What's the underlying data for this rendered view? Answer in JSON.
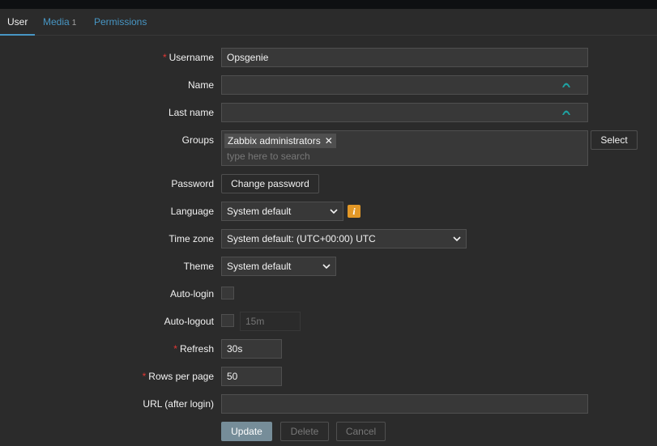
{
  "tabs": [
    {
      "label": "User",
      "count": ""
    },
    {
      "label": "Media",
      "count": "1"
    },
    {
      "label": "Permissions",
      "count": ""
    }
  ],
  "form": {
    "username": {
      "label": "Username",
      "value": "Opsgenie"
    },
    "name": {
      "label": "Name",
      "value": ""
    },
    "lastname": {
      "label": "Last name",
      "value": ""
    },
    "groups": {
      "label": "Groups",
      "chip": "Zabbix administrators",
      "placeholder": "type here to search",
      "select_label": "Select"
    },
    "password": {
      "label": "Password",
      "button": "Change password"
    },
    "language": {
      "label": "Language",
      "value": "System default"
    },
    "timezone": {
      "label": "Time zone",
      "value": "System default: (UTC+00:00) UTC"
    },
    "theme": {
      "label": "Theme",
      "value": "System default"
    },
    "autologin": {
      "label": "Auto-login",
      "checked": false
    },
    "autologout": {
      "label": "Auto-logout",
      "checked": false,
      "placeholder": "15m"
    },
    "refresh": {
      "label": "Refresh",
      "value": "30s"
    },
    "rows": {
      "label": "Rows per page",
      "value": "50"
    },
    "url": {
      "label": "URL (after login)",
      "value": ""
    }
  },
  "actions": {
    "update": "Update",
    "delete": "Delete",
    "cancel": "Cancel"
  },
  "icons": {
    "info": "info-icon",
    "eye": "password-manager-icon",
    "chevron": "chevron-down-icon",
    "remove": "close-icon"
  },
  "colors": {
    "accent": "#4796c4",
    "required": "#e33734",
    "warning": "#e39827",
    "primary_button": "#768d99"
  }
}
